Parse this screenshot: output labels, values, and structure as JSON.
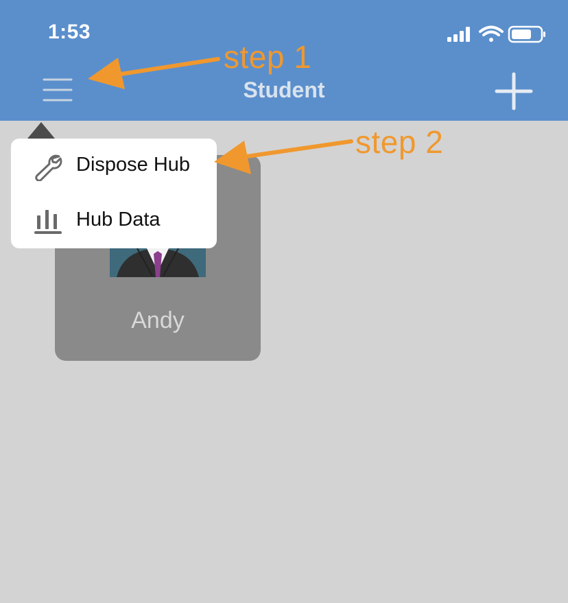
{
  "status_bar": {
    "time": "1:53",
    "icons": [
      "signal-icon",
      "wifi-icon",
      "battery-icon"
    ]
  },
  "nav": {
    "title": "Student",
    "left_icon": "hamburger-menu-icon",
    "right_icon": "plus-icon",
    "background": "#5b8fcc"
  },
  "popover": {
    "items": [
      {
        "label": "Dispose Hub",
        "icon": "wrench-icon"
      },
      {
        "label": "Hub Data",
        "icon": "bar-chart-icon"
      }
    ]
  },
  "student_card": {
    "name": "Andy",
    "image": "student-avatar"
  },
  "annotations": [
    {
      "text": "step 1",
      "target": "menu-button"
    },
    {
      "text": "step 2",
      "target": "popover-item-dispose-hub"
    }
  ],
  "colors": {
    "annotation": "#f0982e",
    "background": "#d3d3d3",
    "card": "#8a8a8a"
  }
}
